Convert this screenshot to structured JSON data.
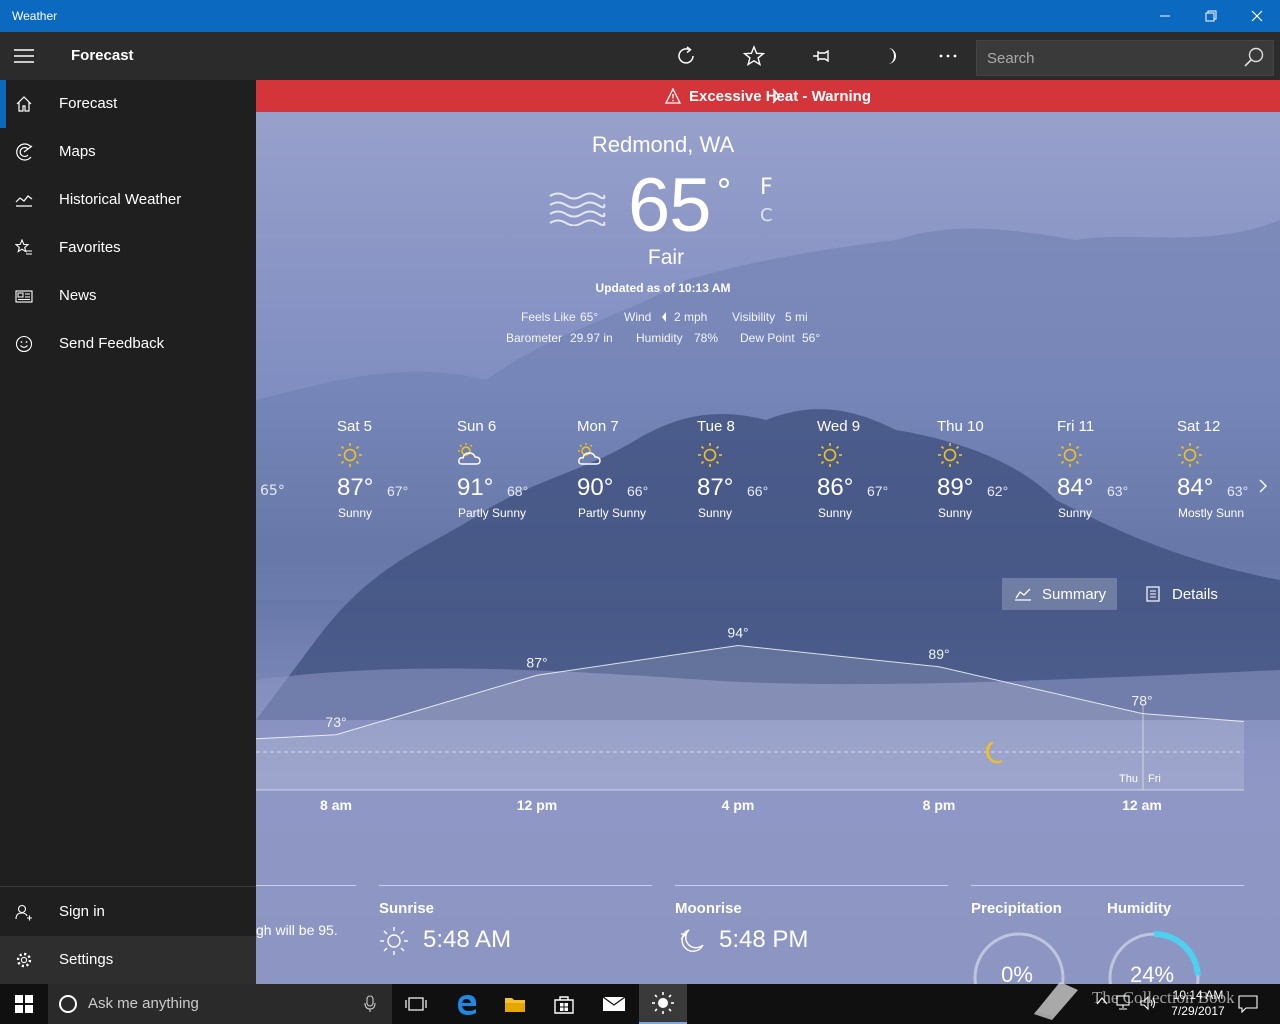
{
  "window": {
    "title": "Weather"
  },
  "commandbar": {
    "title": "Forecast",
    "search_placeholder": "Search"
  },
  "sidebar": {
    "items": [
      {
        "label": "Forecast"
      },
      {
        "label": "Maps"
      },
      {
        "label": "Historical Weather"
      },
      {
        "label": "Favorites"
      },
      {
        "label": "News"
      },
      {
        "label": "Send Feedback"
      }
    ],
    "bottom": [
      {
        "label": "Sign in"
      },
      {
        "label": "Settings"
      }
    ]
  },
  "alert": {
    "text": "Excessive Heat - Warning"
  },
  "current": {
    "city": "Redmond, WA",
    "temp": "65",
    "degree": "°",
    "unit_f": "F",
    "unit_c": "C",
    "condition": "Fair",
    "updated": "Updated as of 10:13 AM",
    "feels_like_label": "Feels Like",
    "feels_like": "65°",
    "wind_label": "Wind",
    "wind": "2 mph",
    "visibility_label": "Visibility",
    "visibility": "5 mi",
    "barometer_label": "Barometer",
    "barometer": "29.97 in",
    "humidity_label": "Humidity",
    "humidity": "78%",
    "dewpoint_label": "Dew Point",
    "dewpoint": "56°"
  },
  "daily": {
    "prev_low": "65°",
    "days": [
      {
        "name": "Sat 5",
        "high": "87°",
        "low": "67°",
        "cond": "Sunny",
        "icon": "sun"
      },
      {
        "name": "Sun 6",
        "high": "91°",
        "low": "68°",
        "cond": "Partly Sunny",
        "icon": "partly-sunny"
      },
      {
        "name": "Mon 7",
        "high": "90°",
        "low": "66°",
        "cond": "Partly Sunny",
        "icon": "partly-sunny"
      },
      {
        "name": "Tue 8",
        "high": "87°",
        "low": "66°",
        "cond": "Sunny",
        "icon": "sun"
      },
      {
        "name": "Wed 9",
        "high": "86°",
        "low": "67°",
        "cond": "Sunny",
        "icon": "sun"
      },
      {
        "name": "Thu 10",
        "high": "89°",
        "low": "62°",
        "cond": "Sunny",
        "icon": "sun"
      },
      {
        "name": "Fri 11",
        "high": "84°",
        "low": "63°",
        "cond": "Sunny",
        "icon": "sun"
      },
      {
        "name": "Sat 12",
        "high": "84°",
        "low": "63°",
        "cond": "Mostly Sunn",
        "icon": "sun"
      }
    ]
  },
  "tabs": {
    "summary": "Summary",
    "details": "Details"
  },
  "chart_data": {
    "type": "line",
    "x_ticks": [
      "8 am",
      "12 pm",
      "4 pm",
      "8 pm",
      "12 am"
    ],
    "points": [
      {
        "label": "73°",
        "value": 73
      },
      {
        "label": "87°",
        "value": 87
      },
      {
        "label": "94°",
        "value": 94
      },
      {
        "label": "89°",
        "value": 89
      },
      {
        "label": "78°",
        "value": 78
      }
    ],
    "day_marks": [
      "Thu",
      "Fri"
    ]
  },
  "cards": {
    "summary_text": "gh will be 95.",
    "sunrise_title": "Sunrise",
    "sunrise": "5:48 AM",
    "moonrise_title": "Moonrise",
    "moonrise": "5:48 PM",
    "precip_title": "Precipitation",
    "precip": "0%",
    "precip_value": 0,
    "humidity_title": "Humidity",
    "humidity": "24%",
    "humidity_value": 24
  },
  "taskbar": {
    "cortana_text": "Ask me anything",
    "time": "10:14 AM",
    "date": "7/29/2017"
  },
  "watermark": "The Collection Book",
  "colors": {
    "accent": "#0b6abf",
    "alert": "#d4353a",
    "sun": "#f2c21b",
    "humidity_ring": "#4fd0f0"
  }
}
